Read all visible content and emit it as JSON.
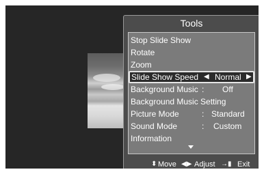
{
  "tools": {
    "title": "Tools",
    "items": [
      {
        "label": "Stop Slide Show"
      },
      {
        "label": "Rotate"
      },
      {
        "label": "Zoom"
      },
      {
        "label": "Slide Show Speed",
        "value": "Normal",
        "selected": true
      },
      {
        "label": "Background Music",
        "sep": ":",
        "value": "Off"
      },
      {
        "label": "Background Music Setting"
      },
      {
        "label": "Picture Mode",
        "sep": ":",
        "value": "Standard"
      },
      {
        "label": "Sound Mode",
        "sep": ":",
        "value": "Custom"
      },
      {
        "label": "Information"
      }
    ],
    "footer": {
      "move_icon": "up-down-arrows-icon",
      "move_label": "Move",
      "adjust_icon": "left-right-arrows-icon",
      "adjust_label": "Adjust",
      "exit_icon": "exit-icon",
      "exit_label": "Exit"
    }
  },
  "colors": {
    "screen_background": "#262626",
    "panel_background": "#4c4c4c",
    "list_background": "#7b7b7b",
    "selected_background": "#2b2b2b",
    "text": "#ffffff"
  }
}
